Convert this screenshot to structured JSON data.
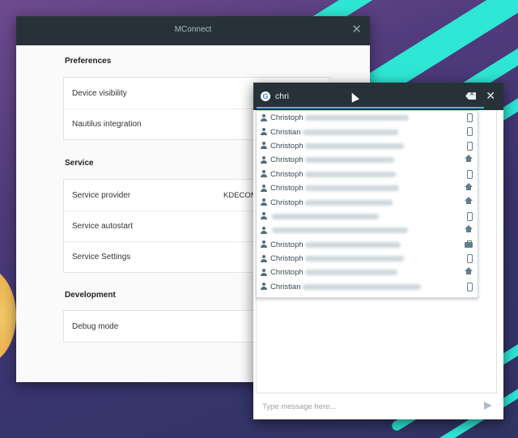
{
  "main_window": {
    "title": "MConnect",
    "sections": {
      "preferences": {
        "heading": "Preferences",
        "rows": [
          "Device visibility",
          "Nautilus integration"
        ]
      },
      "service": {
        "heading": "Service",
        "provider_label": "Service provider",
        "provider_value": "KDECON",
        "autostart_label": "Service autostart",
        "settings_label": "Service Settings"
      },
      "development": {
        "heading": "Development",
        "rows": [
          "Debug mode"
        ]
      }
    }
  },
  "popup": {
    "search_value": "chri",
    "message_placeholder": "Type message here...",
    "contacts": [
      {
        "name": "Christoph",
        "type": "phone-icon"
      },
      {
        "name": "Christian",
        "type": "phone-icon"
      },
      {
        "name": "Christoph",
        "type": "phone-icon"
      },
      {
        "name": "Christoph",
        "type": "home-icon"
      },
      {
        "name": "Christoph",
        "type": "phone-icon"
      },
      {
        "name": "Christoph",
        "type": "home-icon"
      },
      {
        "name": "Christoph",
        "type": "home-icon"
      },
      {
        "name": "",
        "type": "phone-icon"
      },
      {
        "name": "",
        "type": "home-icon"
      },
      {
        "name": "Christoph",
        "type": "work-icon"
      },
      {
        "name": "Christoph",
        "type": "phone-icon"
      },
      {
        "name": "Christoph",
        "type": "home-icon"
      },
      {
        "name": "Christian",
        "type": "phone-icon"
      }
    ]
  },
  "colors": {
    "titlebar": "#263238",
    "accent": "#26c6da",
    "stripe": "#2ee6d4"
  }
}
